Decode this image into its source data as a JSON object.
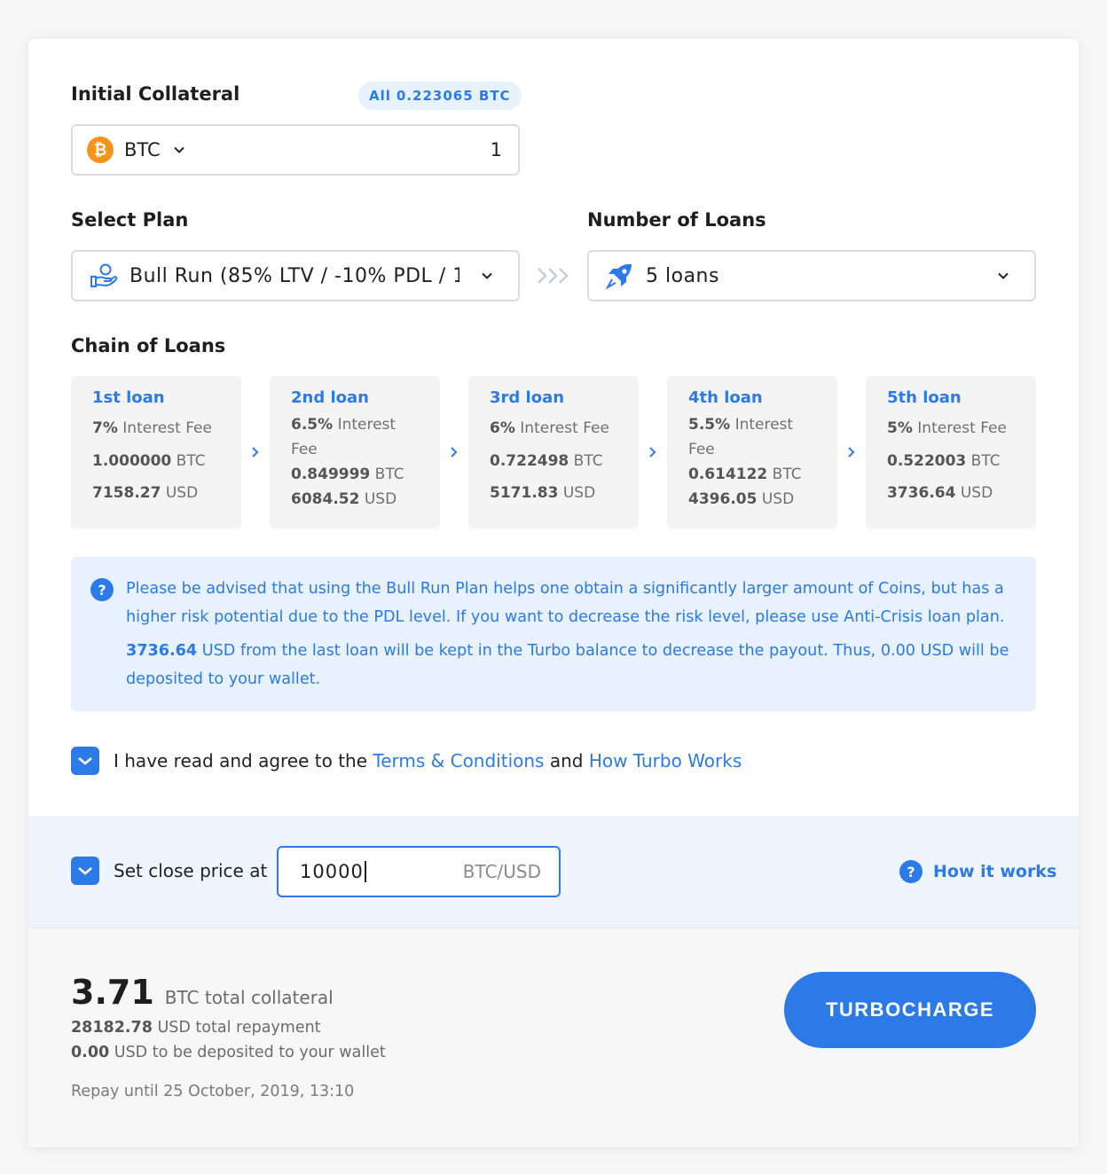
{
  "collateral": {
    "label": "Initial Collateral",
    "all_prefix": "All",
    "all_amount": "0.223065 BTC",
    "currency": "BTC",
    "coin_icon": "bitcoin-icon",
    "amount_value": "1"
  },
  "plan": {
    "label": "Select Plan",
    "selected": "Bull Run (85% LTV / -10% PDL / 1",
    "icon": "hand-coin-icon"
  },
  "loans_count": {
    "label": "Number of Loans",
    "selected": "5 loans",
    "icon": "rocket-icon"
  },
  "chain": {
    "label": "Chain of Loans",
    "loans": [
      {
        "title": "1st loan",
        "rate": "7%",
        "rate_label": "Interest Fee",
        "btc": "1.000000",
        "btc_unit": "BTC",
        "usd": "7158.27",
        "usd_unit": "USD"
      },
      {
        "title": "2nd loan",
        "rate": "6.5%",
        "rate_label": "Interest Fee",
        "btc": "0.849999",
        "btc_unit": "BTC",
        "usd": "6084.52",
        "usd_unit": "USD"
      },
      {
        "title": "3rd loan",
        "rate": "6%",
        "rate_label": "Interest Fee",
        "btc": "0.722498",
        "btc_unit": "BTC",
        "usd": "5171.83",
        "usd_unit": "USD"
      },
      {
        "title": "4th loan",
        "rate": "5.5%",
        "rate_label": "Interest Fee",
        "btc": "0.614122",
        "btc_unit": "BTC",
        "usd": "4396.05",
        "usd_unit": "USD"
      },
      {
        "title": "5th loan",
        "rate": "5%",
        "rate_label": "Interest Fee",
        "btc": "0.522003",
        "btc_unit": "BTC",
        "usd": "3736.64",
        "usd_unit": "USD"
      }
    ]
  },
  "notice": {
    "para1": "Please be advised that using the Bull Run Plan helps one obtain a significantly larger amount of Coins, but has a higher risk potential due to the PDL level. If you want to decrease the risk level, please use Anti-Crisis loan plan.",
    "amount": "3736.64",
    "para2": " USD from the last loan will be kept in the Turbo balance to decrease the payout. Thus, 0.00 USD will be deposited to your wallet."
  },
  "agreement": {
    "checked": true,
    "prefix": "I have read and agree to the ",
    "terms_link": "Terms & Conditions",
    "middle": " and ",
    "how_link": "How Turbo Works"
  },
  "close_price": {
    "checked": true,
    "label": "Set close price at",
    "value": "10000",
    "unit": "BTC/USD",
    "help_link": "How it works"
  },
  "summary": {
    "total_collateral": "3.71",
    "total_collateral_label": "BTC total collateral",
    "repayment": "28182.78",
    "repayment_label": "USD total repayment",
    "deposit": "0.00",
    "deposit_label": "USD to be deposited to your wallet",
    "repay_until": "Repay until 25 October, 2019, 13:10"
  },
  "actions": {
    "turbocharge": "TURBOCHARGE"
  },
  "colors": {
    "accent": "#2c7ae8",
    "bitcoin": "#f7931a",
    "info_bg": "#e8f1fe"
  }
}
